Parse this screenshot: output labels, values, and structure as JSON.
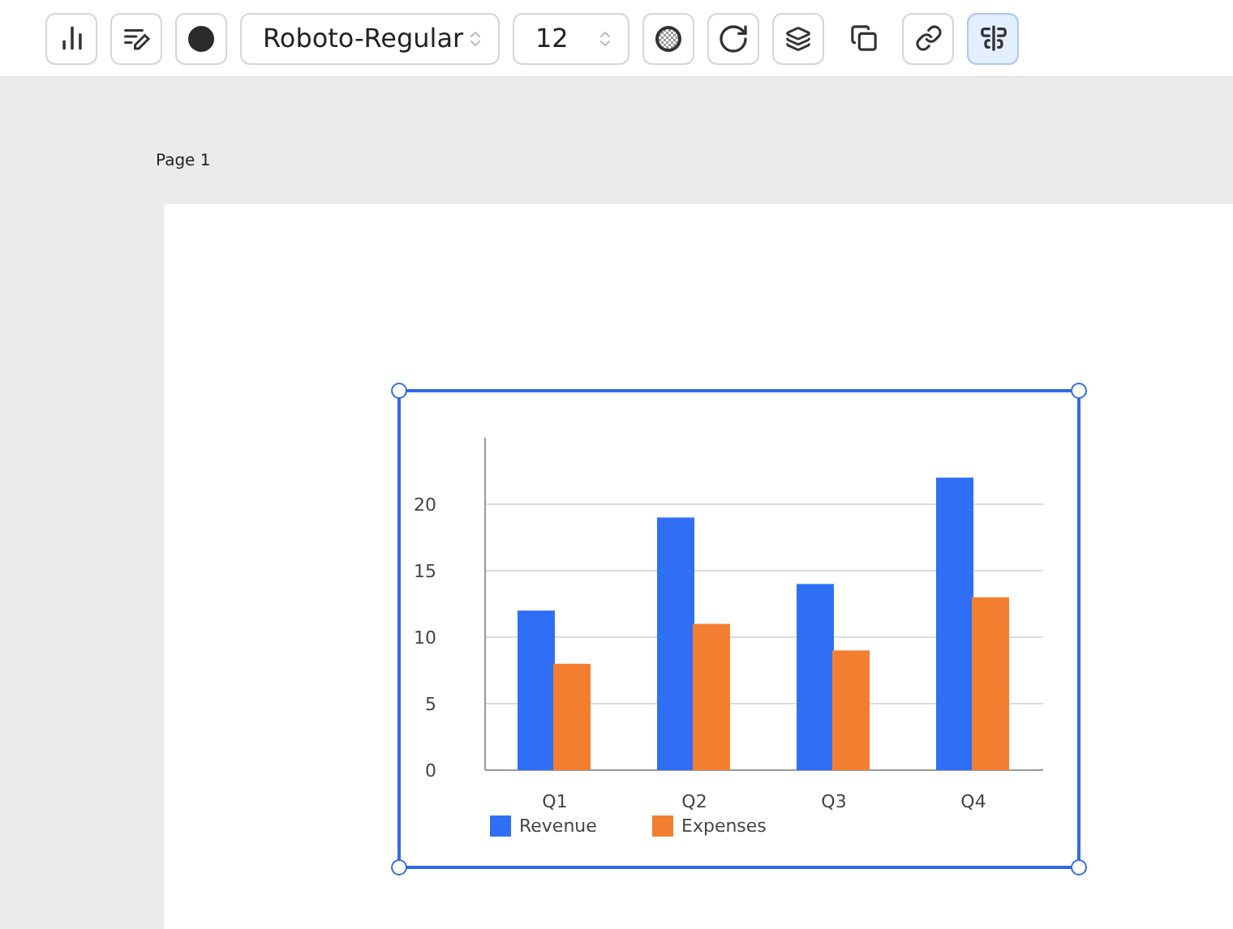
{
  "toolbar": [
    {
      "kind": "button",
      "selected": false
    },
    {
      "kind": "button",
      "selected": false
    },
    {
      "kind": "swatch",
      "color": "#2b2b2b"
    },
    {
      "kind": "select",
      "value": "Roboto-Regular"
    },
    {
      "kind": "select",
      "value": "12"
    },
    {
      "kind": "button",
      "selected": false
    },
    {
      "kind": "button",
      "selected": false
    },
    {
      "kind": "button",
      "selected": false
    },
    {
      "kind": "plain",
      "selected": false
    },
    {
      "kind": "button",
      "selected": false
    },
    {
      "kind": "button",
      "selected": true
    }
  ],
  "page": {
    "label": "Page 1",
    "chart": {
      "selected": true,
      "chart_data": {
        "type": "bar",
        "categories": [
          "Q1",
          "Q2",
          "Q3",
          "Q4"
        ],
        "series": [
          {
            "name": "Revenue",
            "color": "#2f6ff5",
            "values": [
              12,
              19,
              14,
              22
            ]
          },
          {
            "name": "Expenses",
            "color": "#f47e30",
            "values": [
              8,
              11,
              9,
              13
            ]
          }
        ],
        "ylim": [
          0,
          25
        ],
        "yticks": [
          0,
          5,
          10,
          15,
          20
        ],
        "grid": true,
        "legend": true
      }
    }
  }
}
